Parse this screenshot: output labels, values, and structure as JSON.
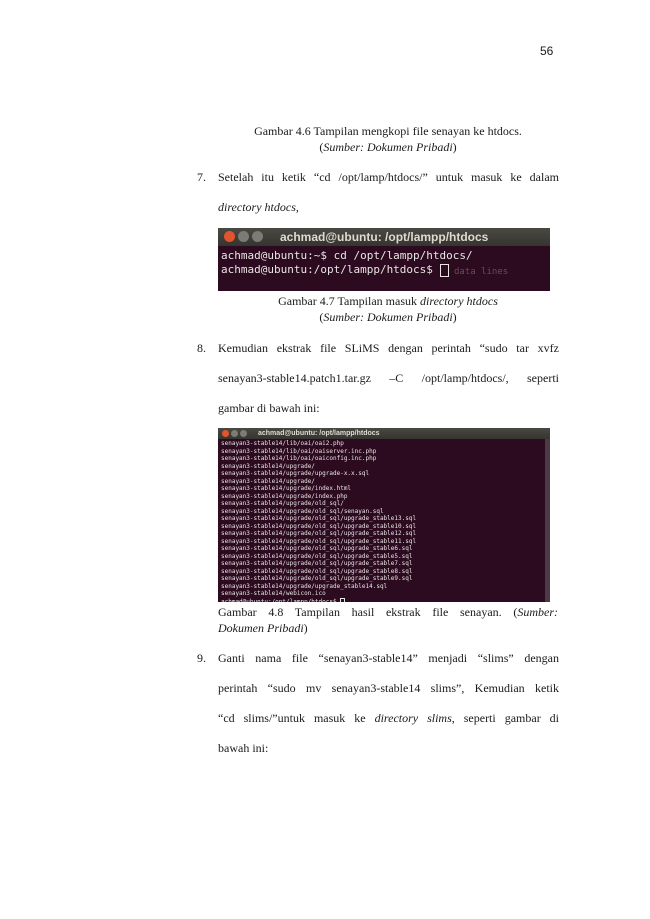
{
  "page_number": "56",
  "figure_4_6": {
    "caption_main": "Gambar 4.6 Tampilan mengkopi file senayan ke htdocs.",
    "source_prefix": "(",
    "source": "Sumber: Dokumen Pribadi",
    "source_suffix": ")"
  },
  "step7": {
    "number": "7.",
    "line1": "Setelah itu ketik “cd /opt/lamp/htdocs/” untuk masuk ke dalam",
    "line2_italic": "directory htdocs",
    "line2_rest": ","
  },
  "terminal1": {
    "title": "achmad@ubuntu: /opt/lampp/htdocs",
    "lines": [
      "achmad@ubuntu:~$ cd /opt/lampp/htdocs/",
      "achmad@ubuntu:/opt/lampp/htdocs$ "
    ],
    "ghost": "data lines"
  },
  "figure_4_7": {
    "caption_prefix": "Gambar 4.7 Tampilan masuk ",
    "caption_italic": "directory htdocs",
    "source_prefix": "(",
    "source": "Sumber: Dokumen Pribadi",
    "source_suffix": ")"
  },
  "step8": {
    "number": "8.",
    "line1": "Kemudian ekstrak file SLiMS dengan perintah “sudo tar xvfz",
    "line2": "senayan3-stable14.patch1.tar.gz –C /opt/lamp/htdocs/, seperti",
    "line3": "gambar di bawah ini:"
  },
  "terminal2": {
    "title": "achmad@ubuntu: /opt/lampp/htdocs",
    "lines": [
      "senayan3-stable14/lib/oai/oai2.php",
      "senayan3-stable14/lib/oai/oaiserver.inc.php",
      "senayan3-stable14/lib/oai/oaiconfig.inc.php",
      "senayan3-stable14/upgrade/",
      "senayan3-stable14/upgrade/upgrade-x.x.sql",
      "senayan3-stable14/upgrade/",
      "senayan3-stable14/upgrade/index.html",
      "senayan3-stable14/upgrade/index.php",
      "senayan3-stable14/upgrade/old_sql/",
      "senayan3-stable14/upgrade/old_sql/senayan.sql",
      "senayan3-stable14/upgrade/old_sql/upgrade_stable13.sql",
      "senayan3-stable14/upgrade/old_sql/upgrade_stable10.sql",
      "senayan3-stable14/upgrade/old_sql/upgrade_stable12.sql",
      "senayan3-stable14/upgrade/old_sql/upgrade_stable11.sql",
      "senayan3-stable14/upgrade/old_sql/upgrade_stable6.sql",
      "senayan3-stable14/upgrade/old_sql/upgrade_stable5.sql",
      "senayan3-stable14/upgrade/old_sql/upgrade_stable7.sql",
      "senayan3-stable14/upgrade/old_sql/upgrade_stable8.sql",
      "senayan3-stable14/upgrade/old_sql/upgrade_stable9.sql",
      "senayan3-stable14/upgrade/upgrade_stable14.sql",
      "senayan3-stable14/webicon.ico",
      "achmad@ubuntu:/opt/lampp/htdocs$ "
    ]
  },
  "figure_4_8": {
    "caption_line1": "Gambar 4.8 Tampilan hasil ekstrak file senayan. (",
    "caption_italic1": "Sumber:",
    "caption_italic2": "Dokumen Pribadi",
    "caption_suffix": ")"
  },
  "step9": {
    "number": "9.",
    "line1": "Ganti nama file “senayan3-stable14” menjadi “slims” dengan",
    "line2": "perintah “sudo mv senayan3-stable14 slims”, Kemudian ketik",
    "line3_a": "“cd slims/”untuk masuk ke ",
    "line3_italic": "directory slims",
    "line3_b": ", seperti gambar di",
    "line4": "bawah ini:"
  }
}
